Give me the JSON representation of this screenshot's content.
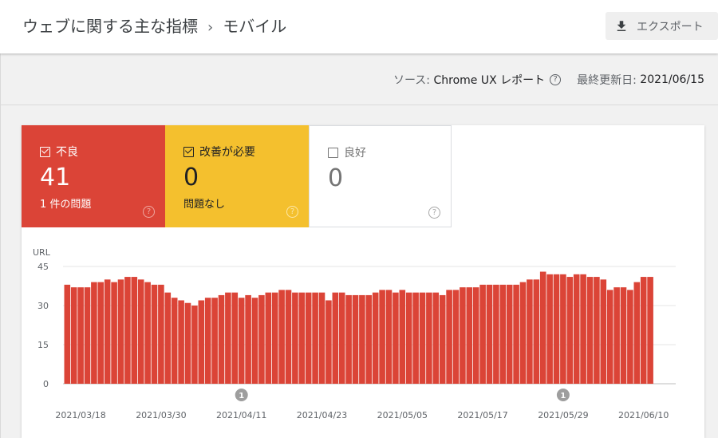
{
  "header": {
    "title": "ウェブに関する主な指標",
    "separator": "›",
    "subtitle": "モバイル",
    "export_label": "エクスポート"
  },
  "meta": {
    "source_label": "ソース:",
    "source_value": "Chrome UX レポート",
    "help": "?",
    "updated_label": "最終更新日:",
    "updated_value": "2021/06/15"
  },
  "tiles": [
    {
      "label": "不良",
      "count": "41",
      "sub": "1 件の問題",
      "checked": true,
      "color": "#db4437"
    },
    {
      "label": "改善が必要",
      "count": "0",
      "sub": "問題なし",
      "checked": true,
      "color": "#f4c02e"
    },
    {
      "label": "良好",
      "count": "0",
      "sub": "",
      "checked": false,
      "color": "#ffffff"
    }
  ],
  "chart_data": {
    "type": "bar",
    "ylabel": "URL",
    "ylim": [
      0,
      45
    ],
    "yticks": [
      0,
      15,
      30,
      45
    ],
    "bar_color": "#db4437",
    "start_date": "2021/03/16",
    "x_tick_labels": [
      "2021/03/18",
      "2021/03/30",
      "2021/04/11",
      "2021/04/23",
      "2021/05/05",
      "2021/05/17",
      "2021/05/29",
      "2021/06/10"
    ],
    "annotations": [
      {
        "date": "2021/04/11",
        "label": "1"
      },
      {
        "date": "2021/05/29",
        "label": "1"
      }
    ],
    "values": [
      38,
      37,
      37,
      37,
      39,
      39,
      40,
      39,
      40,
      41,
      41,
      40,
      39,
      38,
      38,
      35,
      33,
      32,
      31,
      30,
      32,
      33,
      33,
      34,
      35,
      35,
      33,
      34,
      33,
      34,
      35,
      35,
      36,
      36,
      35,
      35,
      35,
      35,
      35,
      32,
      35,
      35,
      34,
      34,
      34,
      34,
      35,
      36,
      36,
      35,
      36,
      35,
      35,
      35,
      35,
      35,
      34,
      36,
      36,
      37,
      37,
      37,
      38,
      38,
      38,
      38,
      38,
      38,
      39,
      40,
      40,
      43,
      42,
      42,
      42,
      41,
      42,
      42,
      41,
      41,
      40,
      36,
      37,
      37,
      36,
      39,
      41,
      41
    ]
  }
}
